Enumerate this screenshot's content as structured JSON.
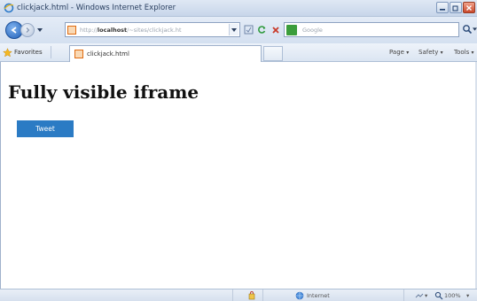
{
  "window": {
    "title": "clickjack.html - Windows Internet Explorer"
  },
  "address_bar": {
    "url_prefix": "http://",
    "url_host": "localhost",
    "url_path": "/~sites/clickjack.ht",
    "search_placeholder": "Google"
  },
  "favorites_bar": {
    "favorites_label": "Favorites",
    "tab_label": "clickjack.html",
    "page_menu": "Page",
    "safety_menu": "Safety",
    "tools_menu": "Tools"
  },
  "page": {
    "heading": "Fully visible iframe",
    "tweet_button": "Tweet"
  },
  "status_bar": {
    "zone_label": "Internet",
    "zoom_label": "100%"
  },
  "colors": {
    "tweet_button_bg": "#2b7bc4",
    "chrome_blue": "#d4e0f0"
  }
}
